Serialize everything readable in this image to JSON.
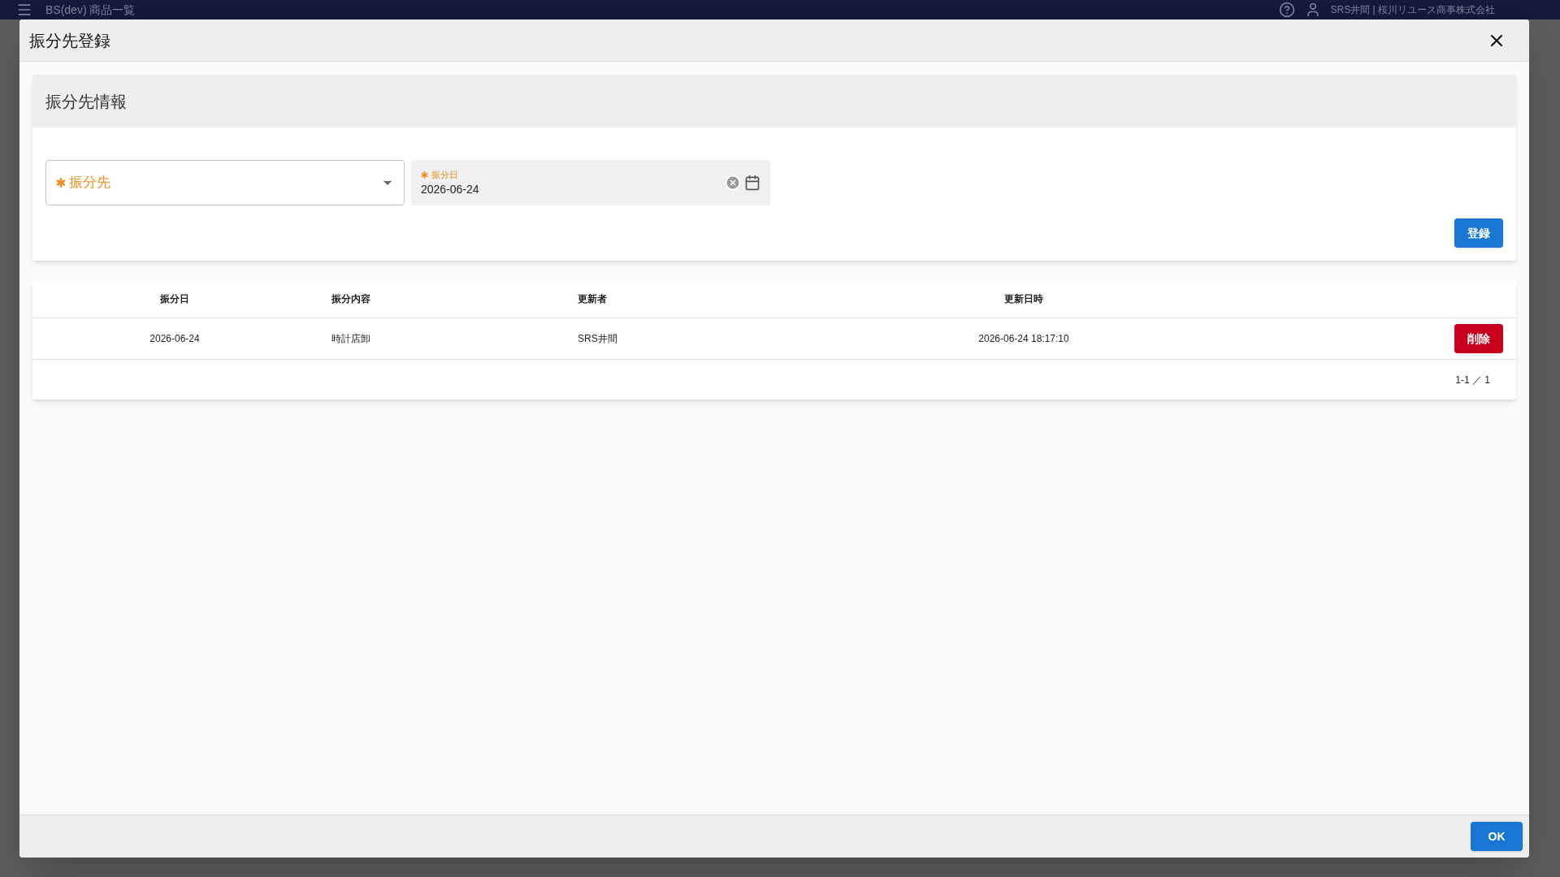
{
  "app_bar": {
    "title": "BS(dev) 商品一覧",
    "user": "SRS井間 | 桜川リユース商事株式会社"
  },
  "dialog": {
    "title": "振分先登録",
    "section": {
      "title": "振分先情報",
      "fields": [
        {
          "kind": "select",
          "label": "振分先",
          "required": true
        },
        {
          "kind": "date",
          "label": "振分日",
          "required": true,
          "value": "2026-06-24"
        }
      ],
      "submit": "登録"
    },
    "table": {
      "columns": [
        "振分日",
        "振分内容",
        "更新者",
        "更新日時"
      ],
      "rows": [
        {
          "cells": [
            "2026-06-24",
            "時計店卸",
            "SRS井間",
            "2026-06-24 18:17:10"
          ],
          "action": "削除"
        }
      ],
      "pagination": "1-1 ／ 1"
    },
    "ok": "OK"
  }
}
